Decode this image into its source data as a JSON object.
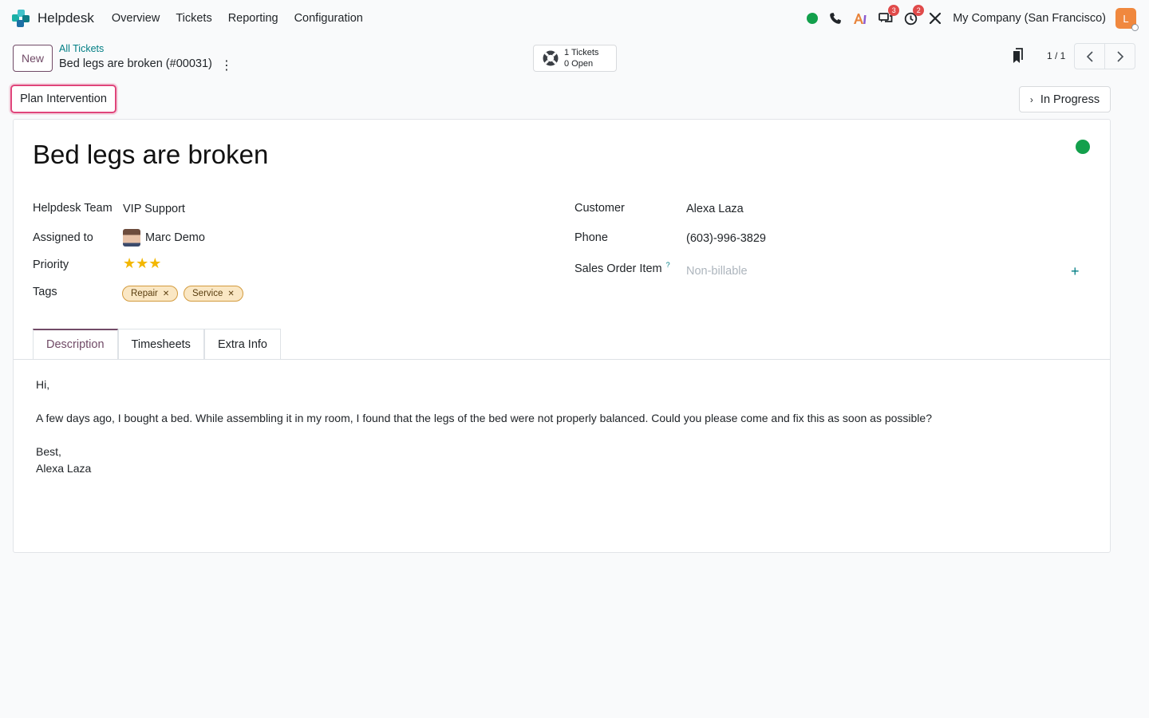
{
  "navbar": {
    "app_name": "Helpdesk",
    "menu": [
      "Overview",
      "Tickets",
      "Reporting",
      "Configuration"
    ],
    "company": "My Company (San Francisco)",
    "avatar_initial": "L",
    "messages_count": "3",
    "activities_count": "2",
    "icons": [
      "presence-dot-icon",
      "phone-icon",
      "ai-icon",
      "messages-icon",
      "activity-clock-icon",
      "tools-icon"
    ]
  },
  "control": {
    "new_label": "New",
    "breadcrumb_parent": "All Tickets",
    "breadcrumb_current": "Bed legs are broken (#00031)",
    "stat": {
      "line1": "1 Tickets",
      "line2": "0 Open"
    },
    "pager": "1 / 1"
  },
  "statusbar": {
    "action_label": "Plan Intervention",
    "stage_label": "In Progress"
  },
  "ticket": {
    "title": "Bed legs are broken",
    "kanban_state_color": "#13a04c",
    "fields_left": {
      "team_label": "Helpdesk Team",
      "team_value": "VIP Support",
      "assigned_label": "Assigned to",
      "assigned_value": "Marc Demo",
      "priority_label": "Priority",
      "priority_stars": 3,
      "tags_label": "Tags",
      "tags": [
        "Repair",
        "Service"
      ]
    },
    "fields_right": {
      "customer_label": "Customer",
      "customer_value": "Alexa Laza",
      "phone_label": "Phone",
      "phone_value": "(603)-996-3829",
      "sale_label": "Sales Order Item",
      "sale_help": "?",
      "sale_placeholder": "Non-billable"
    },
    "tabs": [
      "Description",
      "Timesheets",
      "Extra Info"
    ],
    "active_tab": "Description",
    "description": {
      "greeting": "Hi,",
      "body": "A few days ago, I bought a bed. While assembling it in my room, I found that the legs of the bed were not properly balanced. Could you please come and fix this as soon as possible?",
      "closing": "Best,",
      "signature": "Alexa Laza"
    }
  }
}
